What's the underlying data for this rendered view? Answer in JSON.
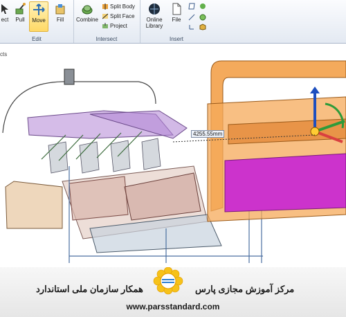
{
  "ribbon": {
    "edit": {
      "label": "Edit",
      "select_label": "ect",
      "pull_label": "Pull",
      "move_label": "Move",
      "fill_label": "Fill"
    },
    "intersect": {
      "label": "Intersect",
      "combine_label": "Combine",
      "split_body_label": "Split Body",
      "split_face_label": "Split Face",
      "project_label": "Project"
    },
    "insert": {
      "label": "Insert",
      "online_library_line1": "Online",
      "online_library_line2": "Library",
      "file_label": "File"
    }
  },
  "viewport": {
    "corner_label": "cts",
    "measurement": "4255.55mm"
  },
  "footer": {
    "title_right": "مرکز آموزش مجازی پارس",
    "title_left": "همکار سازمان ملی استاندارد",
    "website": "www.parsstandard.com"
  },
  "colors": {
    "move_highlight": "#ffd966",
    "orange_part": "#f29b3f",
    "magenta_panel": "#cc33cc",
    "purple_tray": "#b79ad3"
  }
}
